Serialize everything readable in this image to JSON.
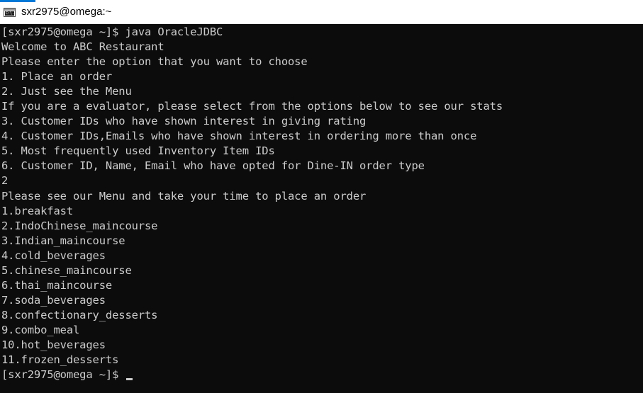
{
  "window": {
    "title": "sxr2975@omega:~",
    "icon": "terminal-icon",
    "icon_text": "C:\\."
  },
  "terminal": {
    "lines": [
      "[sxr2975@omega ~]$ java OracleJDBC",
      "Welcome to ABC Restaurant",
      "Please enter the option that you want to choose",
      "1. Place an order",
      "2. Just see the Menu",
      "If you are a evaluator, please select from the options below to see our stats",
      "3. Customer IDs who have shown interest in giving rating",
      "4. Customer IDs,Emails who have shown interest in ordering more than once",
      "5. Most frequently used Inventory Item IDs",
      "6. Customer ID, Name, Email who have opted for Dine-IN order type",
      "2",
      "Please see our Menu and take your time to place an order",
      "1.breakfast",
      "2.IndoChinese_maincourse",
      "3.Indian_maincourse",
      "4.cold_beverages",
      "5.chinese_maincourse",
      "6.thai_maincourse",
      "7.soda_beverages",
      "8.confectionary_desserts",
      "9.combo_meal",
      "10.hot_beverages",
      "11.frozen_desserts"
    ],
    "prompt": "[sxr2975@omega ~]$ "
  },
  "colors": {
    "background": "#0c0c0c",
    "text": "#cccccc",
    "titlebar": "#ffffff",
    "accent": "#0078d7"
  }
}
